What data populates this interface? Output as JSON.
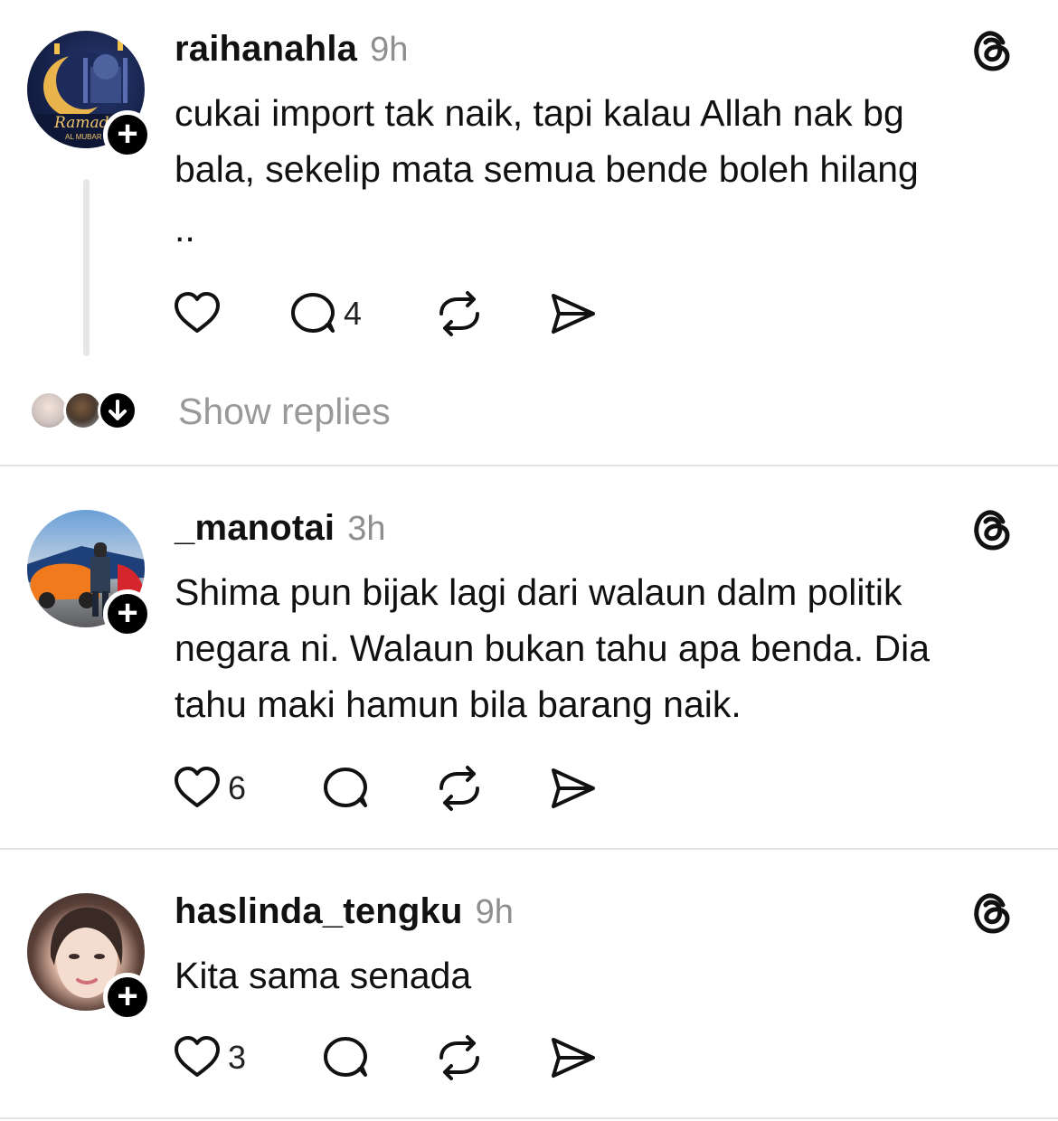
{
  "posts": [
    {
      "username": "raihanahla",
      "time": "9h",
      "text_line1": "cukai import tak naik, tapi kalau Allah nak bg",
      "text_line2": "bala, sekelip mata semua bende boleh hilang",
      "text_line3": "..",
      "avatar_text": "Ramad",
      "avatar_subtext": "AL MUBAR",
      "like_count": "",
      "reply_count": "4",
      "show_replies": "Show replies"
    },
    {
      "username": "_manotai",
      "time": "3h",
      "text_line1": "Shima pun bijak lagi dari walaun dalm politik",
      "text_line2": "negara ni. Walaun bukan tahu apa benda. Dia",
      "text_line3": "tahu maki hamun bila barang naik.",
      "like_count": "6",
      "reply_count": ""
    },
    {
      "username": "haslinda_tengku",
      "time": "9h",
      "text_line1": "Kita sama senada",
      "like_count": "3",
      "reply_count": ""
    }
  ],
  "icons": {
    "follow": "plus-icon",
    "like": "heart-icon",
    "reply": "comment-icon",
    "repost": "repost-icon",
    "share": "send-icon",
    "app": "threads-logo-icon"
  },
  "colors": {
    "text": "#111111",
    "muted": "#8e8e8e",
    "divider": "#e4e4e4",
    "badge": "#000000"
  }
}
